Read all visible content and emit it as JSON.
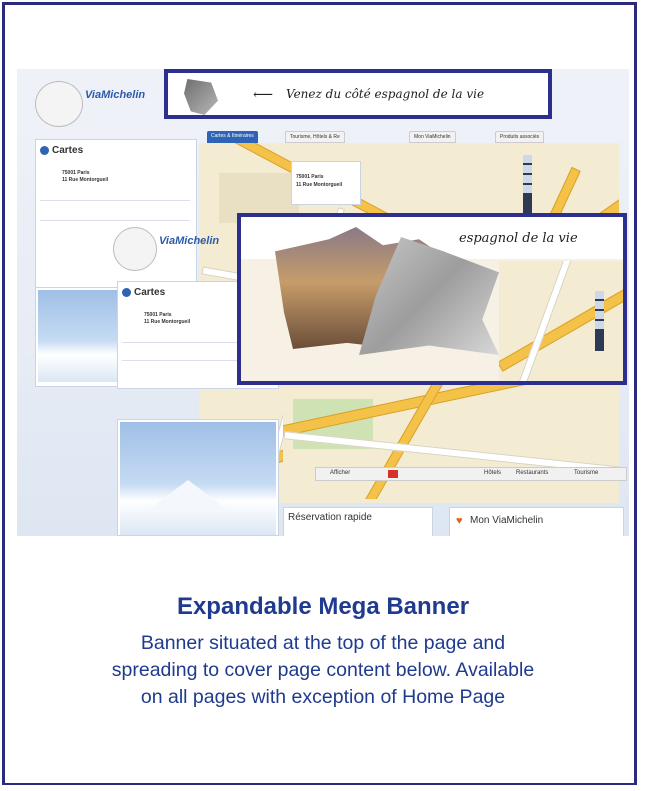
{
  "slide": {
    "title": "Expandable Mega Banner",
    "description_lines": [
      "Banner situated at the top of the page and",
      "spreading to cover page content below. Available",
      "on all pages with exception of Home Page"
    ]
  },
  "screenshot": {
    "logo_text": "ViaMichelin",
    "banner_text": "Venez du côté espagnol de la vie",
    "banner_text_partial": "espagnol de la vie",
    "cartes_label": "Cartes",
    "address_line1": "75001 Paris",
    "address_line2": "11 Rue Montorgueil",
    "tab_cartes": "Cartes & Itinéraires",
    "tab_tourisme": "Tourisme, Hôtels & Re",
    "tab_viamichelin": "Mon ViaMichelin",
    "tab_produits": "Produits associés",
    "reservation_label": "Réservation rapide",
    "mon_viamichelin": "Mon ViaMichelin",
    "afficher_label": "Afficher",
    "hotels_label": "Hôtels",
    "restaurants_label": "Restaurants",
    "tourisme_label": "Tourisme"
  },
  "colors": {
    "frame_border": "#2a2a7e",
    "title_text": "#1f3a8e",
    "banner_border": "#2d2f8f"
  }
}
